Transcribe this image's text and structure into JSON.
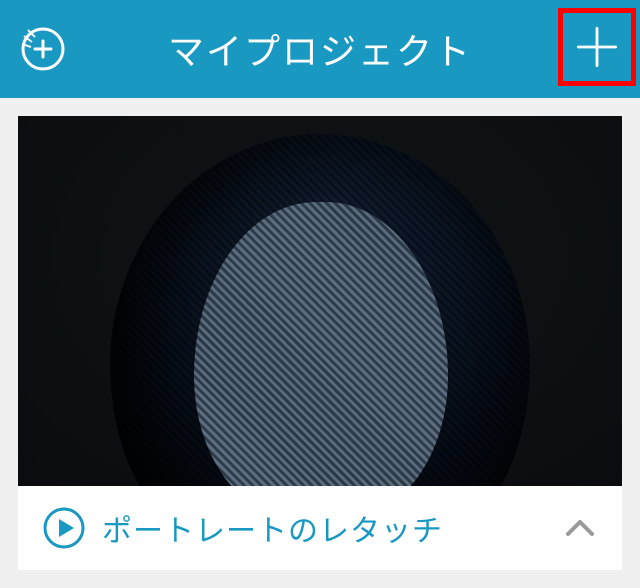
{
  "header": {
    "title": "マイプロジェクト"
  },
  "project": {
    "title": "ポートレートのレタッチ"
  },
  "icons": {
    "logo": "circle-plus-icon",
    "add": "plus-icon",
    "play": "play-circle-icon",
    "collapse": "chevron-up-icon"
  },
  "colors": {
    "header_bg": "#1998c1",
    "accent": "#1998c1",
    "highlight_border": "#ff0000",
    "text_light": "#ffffff"
  }
}
